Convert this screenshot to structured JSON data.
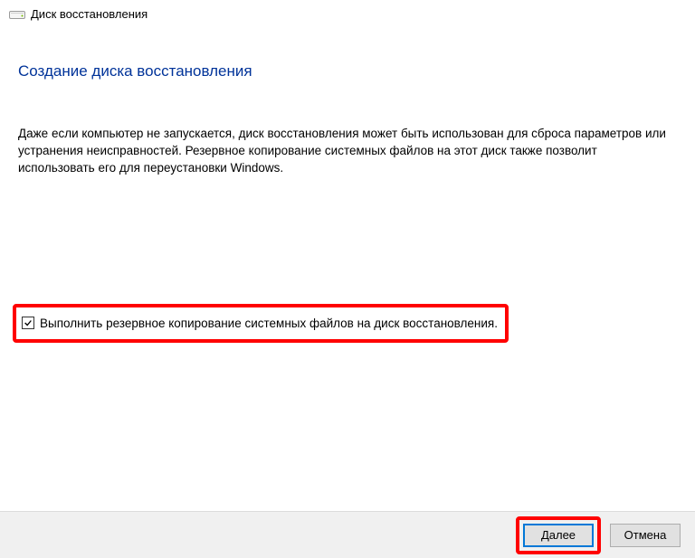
{
  "window": {
    "title": "Диск восстановления"
  },
  "page": {
    "heading": "Создание диска восстановления",
    "description": "Даже если компьютер не запускается, диск восстановления может быть использован для сброса параметров или устранения неисправностей. Резервное копирование системных файлов на этот диск также позволит использовать его для переустановки Windows."
  },
  "checkbox": {
    "checked": true,
    "label": "Выполнить резервное копирование системных файлов на диск восстановления."
  },
  "buttons": {
    "next": "Далее",
    "cancel": "Отмена"
  }
}
